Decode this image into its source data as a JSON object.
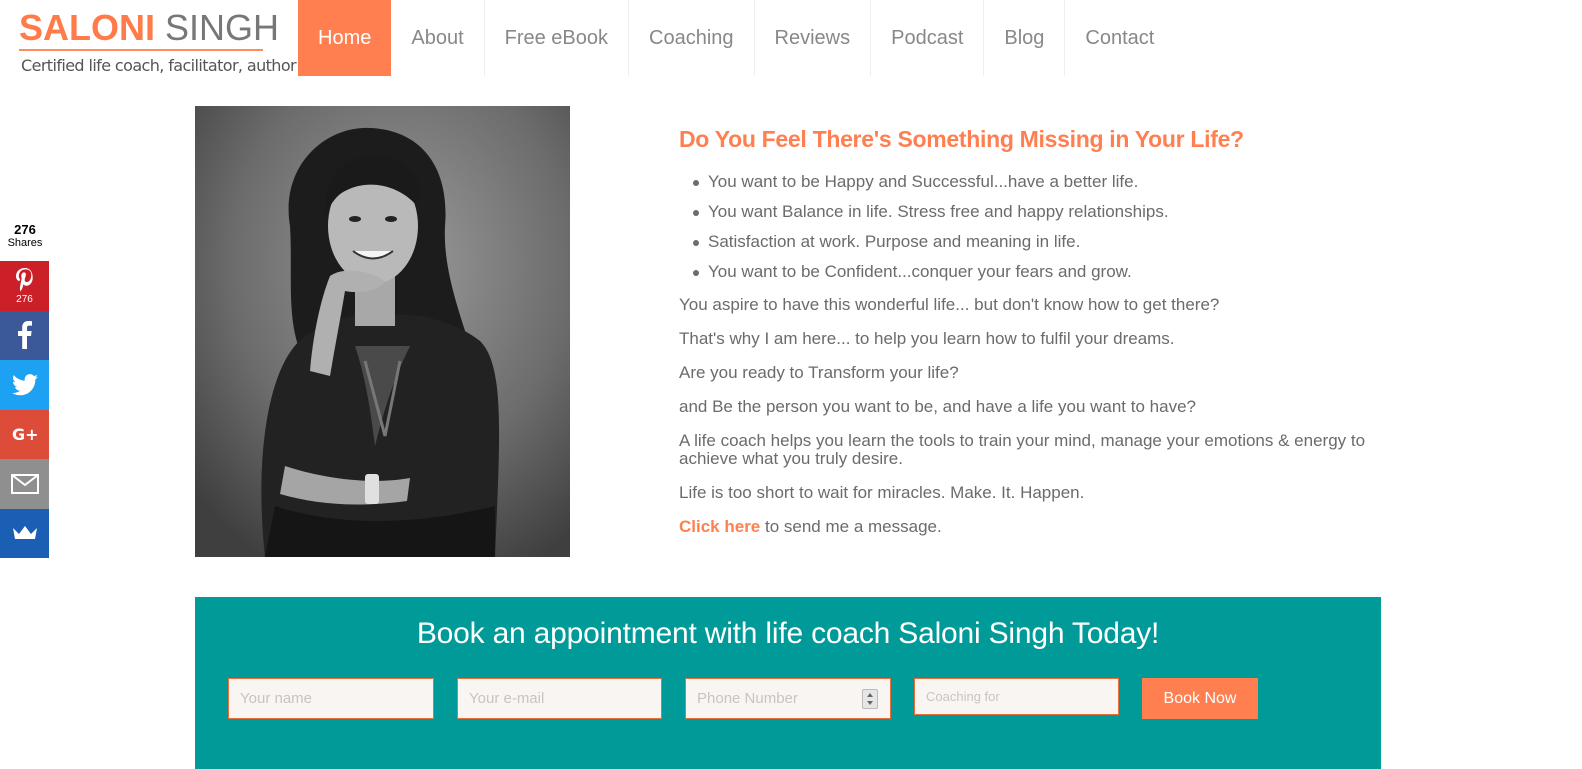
{
  "logo": {
    "first": "SALONI",
    "last": "SINGH",
    "tagline": "Certified life coach, facilitator, author"
  },
  "nav": {
    "items": [
      {
        "label": "Home",
        "active": true
      },
      {
        "label": "About"
      },
      {
        "label": "Free eBook"
      },
      {
        "label": "Coaching"
      },
      {
        "label": "Reviews"
      },
      {
        "label": "Podcast"
      },
      {
        "label": "Blog"
      },
      {
        "label": "Contact"
      }
    ]
  },
  "share": {
    "total": "276",
    "total_label": "Shares",
    "pinterest_count": "276",
    "buttons": [
      "pinterest-icon",
      "facebook-icon",
      "twitter-icon",
      "google-plus-icon",
      "email-icon",
      "sumo-crown-icon"
    ],
    "colors": {
      "pinterest": "#cb2027",
      "facebook": "#3b5998",
      "twitter": "#1da1f2",
      "google_plus": "#dd4b39",
      "email": "#8f8f8f",
      "sumo": "#1a5fb4"
    }
  },
  "main": {
    "headline": "Do You Feel There's Something Missing in Your Life?",
    "bullets": [
      "You want to be Happy and Successful...have a better life.",
      "You want Balance in life. Stress free and happy relationships.",
      "Satisfaction at work. Purpose and meaning in life.",
      "You want to be Confident...conquer your fears and grow."
    ],
    "paragraphs": [
      "You aspire to have this wonderful life... but don't know how to get there?",
      "That's why I am here... to help you learn how to fulfil your dreams.",
      "Are you ready to Transform your life?",
      "and Be the person you want to be, and have a life you want to have?",
      "A life coach helps you learn the tools to train your mind, manage your emotions & energy to achieve what you truly desire.",
      "Life is too short to wait for miracles. Make. It. Happen."
    ],
    "cta_link": "Click here",
    "cta_rest": " to send me a message."
  },
  "booking": {
    "title": "Book an appointment with life coach Saloni Singh Today!",
    "name_placeholder": "Your name",
    "email_placeholder": "Your e-mail",
    "phone_placeholder": "Phone Number",
    "coaching_placeholder": "Coaching for",
    "button": "Book Now"
  },
  "colors": {
    "accent": "#ff7f50",
    "teal": "#009b99"
  }
}
